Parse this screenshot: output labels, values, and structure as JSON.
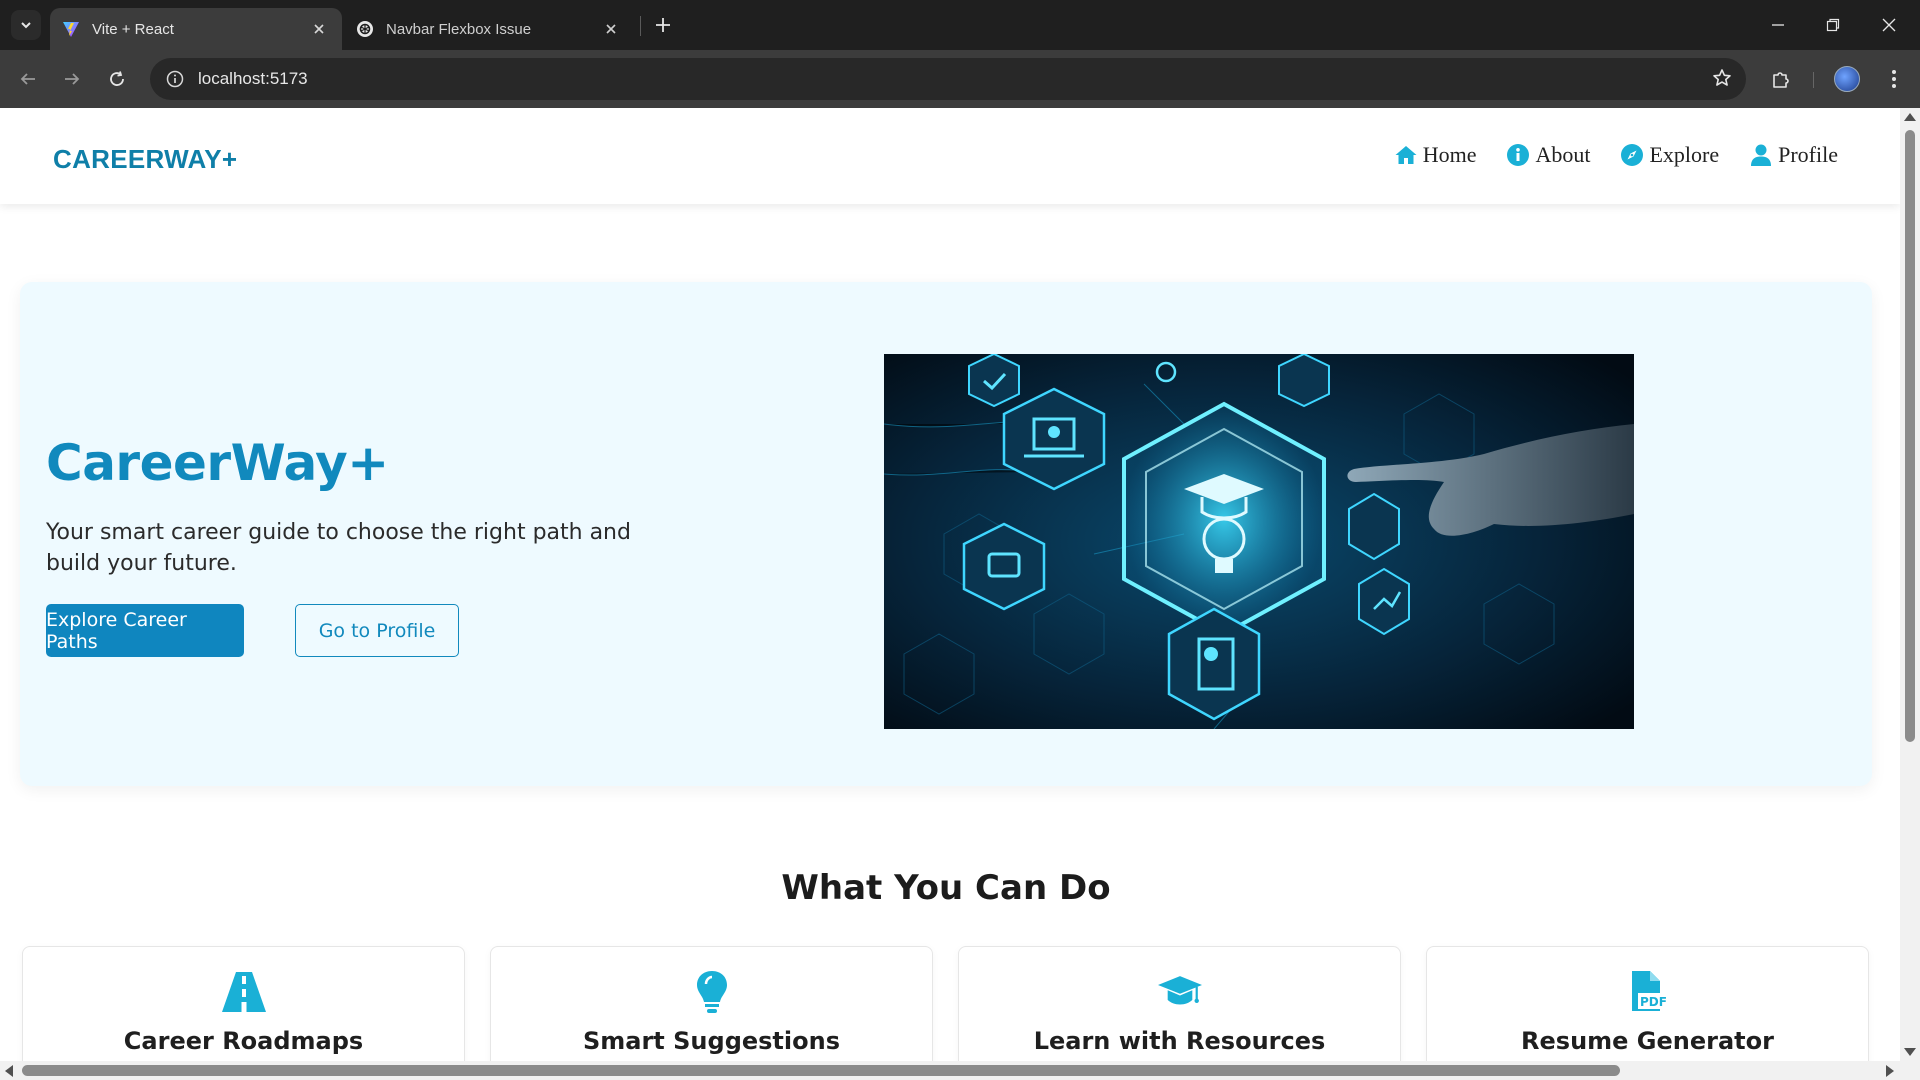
{
  "browser": {
    "tabs": [
      {
        "title": "Vite + React",
        "favicon": "vite-icon"
      },
      {
        "title": "Navbar Flexbox Issue",
        "favicon": "openai-icon"
      }
    ],
    "url": "localhost:5173"
  },
  "site": {
    "logo": "CAREERWAY+",
    "nav": [
      {
        "label": "Home",
        "icon": "home-icon"
      },
      {
        "label": "About",
        "icon": "info-icon"
      },
      {
        "label": "Explore",
        "icon": "compass-icon"
      },
      {
        "label": "Profile",
        "icon": "user-icon"
      }
    ],
    "hero": {
      "title": "CareerWay+",
      "subtitle": "Your smart career guide to choose the right path and build your future.",
      "primary_button": "Explore Career Paths",
      "secondary_button": "Go to Profile"
    },
    "features": {
      "heading": "What You Can Do",
      "cards": [
        {
          "title": "Career Roadmaps",
          "icon": "road-icon"
        },
        {
          "title": "Smart Suggestions",
          "icon": "lightbulb-icon"
        },
        {
          "title": "Learn with Resources",
          "icon": "graduation-cap-icon"
        },
        {
          "title": "Resume Generator",
          "icon": "pdf-file-icon"
        }
      ]
    }
  },
  "colors": {
    "accent": "#1189bd",
    "icon": "#1ab0d6",
    "hero_bg": "#eefaff"
  }
}
